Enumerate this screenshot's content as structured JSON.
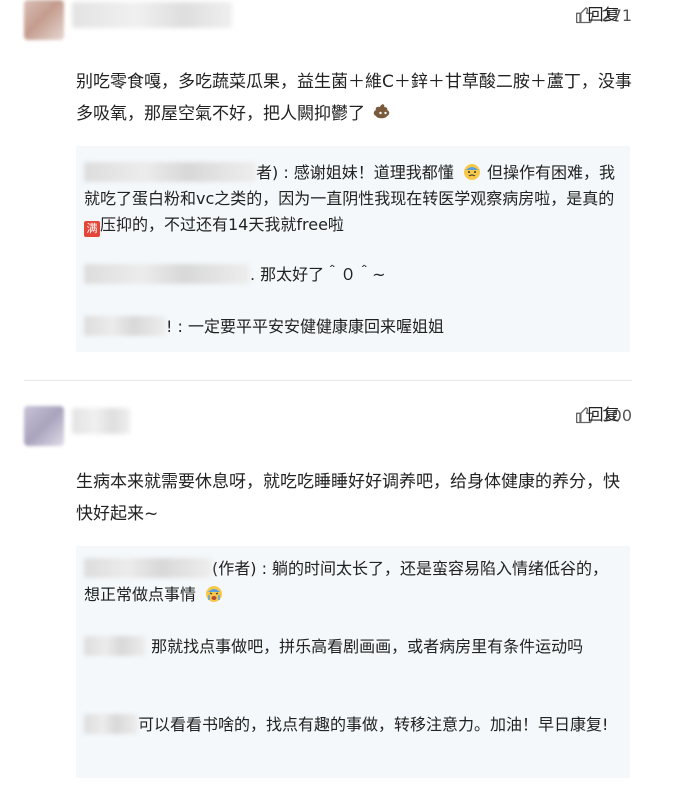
{
  "comments": [
    {
      "likes": "271",
      "reply_label": "回复",
      "text": "别吃零食嘎，多吃蔬菜瓜果，益生菌＋維C＋鋅＋甘草酸二胺＋蘆丁，没事多吸氧，那屋空氣不好，把人闕抑鬱了",
      "replies": [
        {
          "suffix": "者) : 感谢姐妹！道理我都懂",
          "text_after_emoji": " 但操作有困难，我就吃了蛋白粉和vc之类的，因为一直阴性我现在转医学观察病房啦，是真的",
          "hongbao": "满",
          "text_end": "压抑的，不过还有14天我就free啦"
        },
        {
          "suffix": ". 那太好了＾０＾~"
        },
        {
          "suffix": "! : 一定要平平安安健健康康回来喔姐姐"
        }
      ]
    },
    {
      "likes": "100",
      "reply_label": "回复",
      "text": "生病本来就需要休息呀，就吃吃睡睡好好调养吧，给身体健康的养分，快快好起来~",
      "replies": [
        {
          "suffix": "(作者) : 躺的时间太长了，还是蛮容易陷入情绪低谷的，想正常做点事情"
        },
        {
          "suffix": " 那就找点事做吧，拼乐高看剧画画，或者病房里有条件运动吗"
        },
        {
          "suffix": "可以看看书啥的，找点有趣的事做，转移注意力。加油！早日康复!"
        }
      ]
    }
  ],
  "icons": {
    "like": "thumbs-up-icon",
    "emoji1": "sweat-face-emoji",
    "emoji2": "crying-face-emoji",
    "emoji3": "poop-emoji"
  },
  "colors": {
    "reply_bg": "#f4f8fb",
    "text": "#222222",
    "muted": "#555555",
    "hongbao": "#e5463a"
  }
}
